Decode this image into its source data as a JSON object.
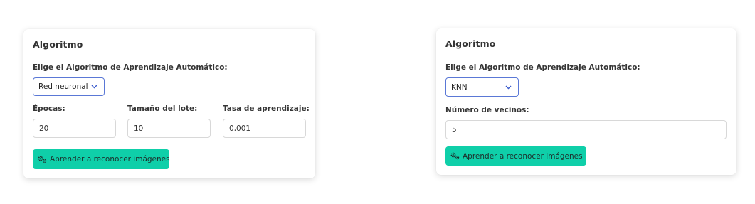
{
  "left_panel": {
    "title": "Algoritmo",
    "algorithm_label": "Elige el Algoritmo de Aprendizaje Automático:",
    "algorithm_selected": "Red neuronal",
    "epochs_label": "Épocas:",
    "epochs_value": "20",
    "batch_label": "Tamaño del lote:",
    "batch_value": "10",
    "lr_label": "Tasa de aprendizaje:",
    "lr_value": "0,001",
    "train_button": "Aprender a reconocer imágenes"
  },
  "right_panel": {
    "title": "Algoritmo",
    "algorithm_label": "Elige el Algoritmo de Aprendizaje Automático:",
    "algorithm_selected": "KNN",
    "neighbors_label": "Número de vecinos:",
    "neighbors_value": "5",
    "train_button": "Aprender a reconocer imágenes"
  },
  "icons": {
    "dropdown": "chevron-down-icon",
    "button": "gears-icon"
  },
  "colors": {
    "button_bg": "#0fcfa9",
    "select_border": "#5a78d6"
  }
}
